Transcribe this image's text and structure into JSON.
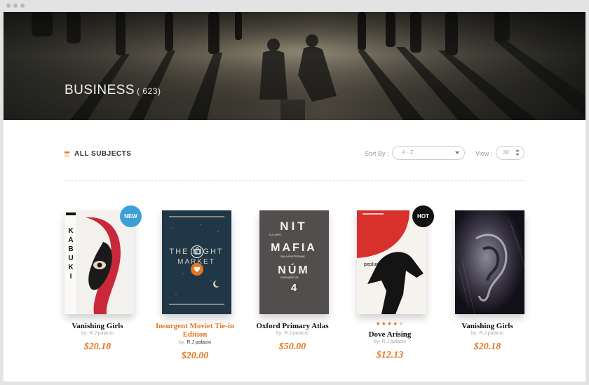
{
  "window": {
    "dots": 3
  },
  "hero": {
    "title": "BUSINESS",
    "count": "( 623)"
  },
  "toolbar": {
    "subjects_label": "ALL SUBJECTS",
    "sort_label": "Sort By :",
    "sort_value": "A - Z",
    "view_label": "View :",
    "view_value": "30"
  },
  "colors": {
    "accent": "#e5761f",
    "new_badge": "#3b9fd8",
    "hot_badge": "#111111"
  },
  "products": [
    {
      "title": "Vanishing Girls",
      "author_prefix": "by:",
      "author": "R.J palacio",
      "price": "$20.18",
      "badge": "NEW",
      "cover_text": "KABUKI"
    },
    {
      "title": "Insurgent Moviet Tie-in Edition",
      "author_prefix": "by:",
      "author": "R.J palacio",
      "price": "$20.00",
      "cover_text": "THE NIGHT MARKET",
      "cover_icons": [
        "bag-icon",
        "heart-icon"
      ]
    },
    {
      "title": "Oxford Primary Atlas",
      "author_prefix": "by:",
      "author": "R.J palacio",
      "price": "$50.00",
      "cover_lines": [
        "NIT",
        "MAFIA",
        "NÚM",
        "4"
      ],
      "cover_small": [
        "DJ CAPO",
        "SALA PASTERNAK",
        "DISSABTE 25"
      ]
    },
    {
      "title": "Dove Arising",
      "author_prefix": "by:",
      "author": "R.J palacio",
      "price": "$12.13",
      "badge": "HOT",
      "rating": 4,
      "rating_max": 5,
      "cover_text": "peplum"
    },
    {
      "title": "Vanishing Girls",
      "author_prefix": "by:",
      "author": "R.J palacio",
      "price": "$20.18"
    }
  ]
}
